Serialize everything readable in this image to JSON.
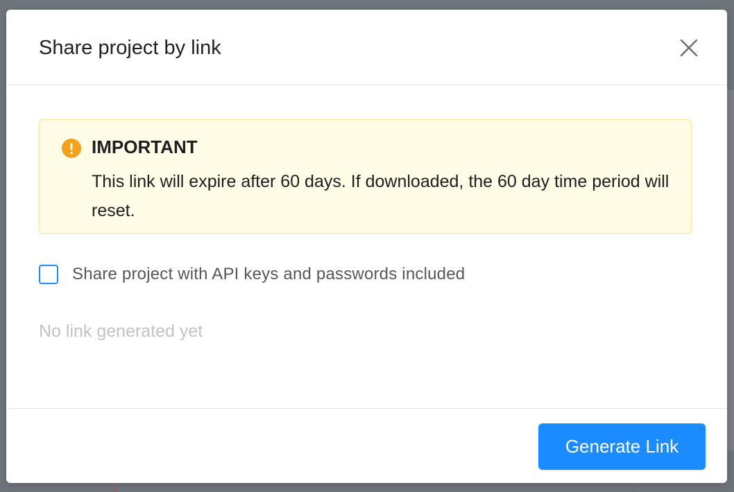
{
  "modal": {
    "title": "Share project by link",
    "close_icon": "close-icon"
  },
  "alert": {
    "icon": "warning-icon",
    "title": "IMPORTANT",
    "message": "This link will expire after 60 days. If downloaded, the 60 day time period will reset."
  },
  "options": {
    "include_secrets_label": "Share project with API keys and passwords included",
    "include_secrets_checked": false
  },
  "link": {
    "status_text": "No link generated yet"
  },
  "footer": {
    "generate_label": "Generate Link"
  },
  "colors": {
    "accent": "#1a8cff",
    "warning": "#f4a11d",
    "alert_bg": "#fefbe6",
    "alert_border": "#f8e59a",
    "overlay": "#6f737a"
  }
}
